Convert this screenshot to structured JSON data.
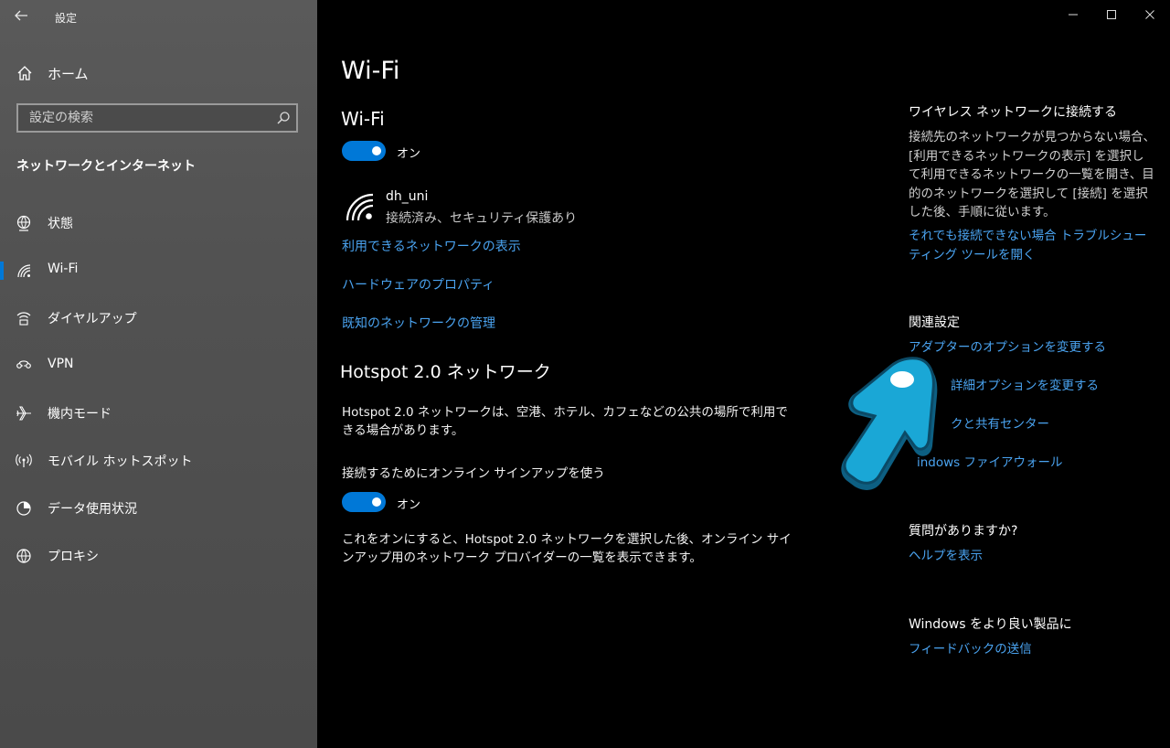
{
  "window": {
    "title": "設定",
    "controls": [
      "minimize-icon",
      "maximize-icon",
      "close-icon"
    ]
  },
  "sidebar": {
    "home_label": "ホーム",
    "search_placeholder": "設定の検索",
    "section_heading": "ネットワークとインターネット",
    "items": [
      {
        "label": "状態",
        "icon": "globe-status-icon"
      },
      {
        "label": "Wi-Fi",
        "icon": "wifi-icon",
        "selected": true
      },
      {
        "label": "ダイヤルアップ",
        "icon": "dialup-icon"
      },
      {
        "label": "VPN",
        "icon": "vpn-icon"
      },
      {
        "label": "機内モード",
        "icon": "airplane-icon"
      },
      {
        "label": "モバイル ホットスポット",
        "icon": "hotspot-icon"
      },
      {
        "label": "データ使用状況",
        "icon": "data-usage-icon"
      },
      {
        "label": "プロキシ",
        "icon": "globe-icon"
      }
    ]
  },
  "main": {
    "title": "Wi-Fi",
    "wifi_heading": "Wi-Fi",
    "wifi_toggle_label": "オン",
    "network": {
      "name": "dh_uni",
      "status": "接続済み、セキュリティ保護あり"
    },
    "links": {
      "show_networks": "利用できるネットワークの表示",
      "hardware_properties": "ハードウェアのプロパティ",
      "manage_known": "既知のネットワークの管理"
    },
    "hotspot": {
      "heading": "Hotspot 2.0 ネットワーク",
      "description": "Hotspot 2.0 ネットワークは、空港、ホテル、カフェなどの公共の場所で利用できる場合があります。",
      "signup_label": "接続するためにオンライン サインアップを使う",
      "signup_toggle_label": "オン",
      "signup_description": "これをオンにすると、Hotspot 2.0 ネットワークを選択した後、オンライン サインアップ用のネットワーク プロバイダーの一覧を表示できます。"
    }
  },
  "right_panel": {
    "connect_heading": "ワイヤレス ネットワークに接続する",
    "connect_text": "接続先のネットワークが見つからない場合、[利用できるネットワークの表示] を選択して利用できるネットワークの一覧を開き、目的のネットワークを選択して [接続] を選択した後、手順に従います。",
    "troubleshoot_link": "それでも接続できない場合 トラブルシューティング ツールを開く",
    "related_heading": "関連設定",
    "related_links": [
      "アダプターのオプションを変更する",
      "詳細オプションを変更する",
      "クと共有センター",
      "indows ファイアウォール"
    ],
    "question_heading": "質問がありますか?",
    "help_link": "ヘルプを表示",
    "feedback_heading": "Windows をより良い製品に",
    "feedback_link": "フィードバックの送信"
  },
  "colors": {
    "accent": "#0078d7",
    "link": "#4aa3f0",
    "sidebar_bg": "#525252",
    "main_bg": "#000000",
    "cursor_fill": "#1aa7d6"
  }
}
